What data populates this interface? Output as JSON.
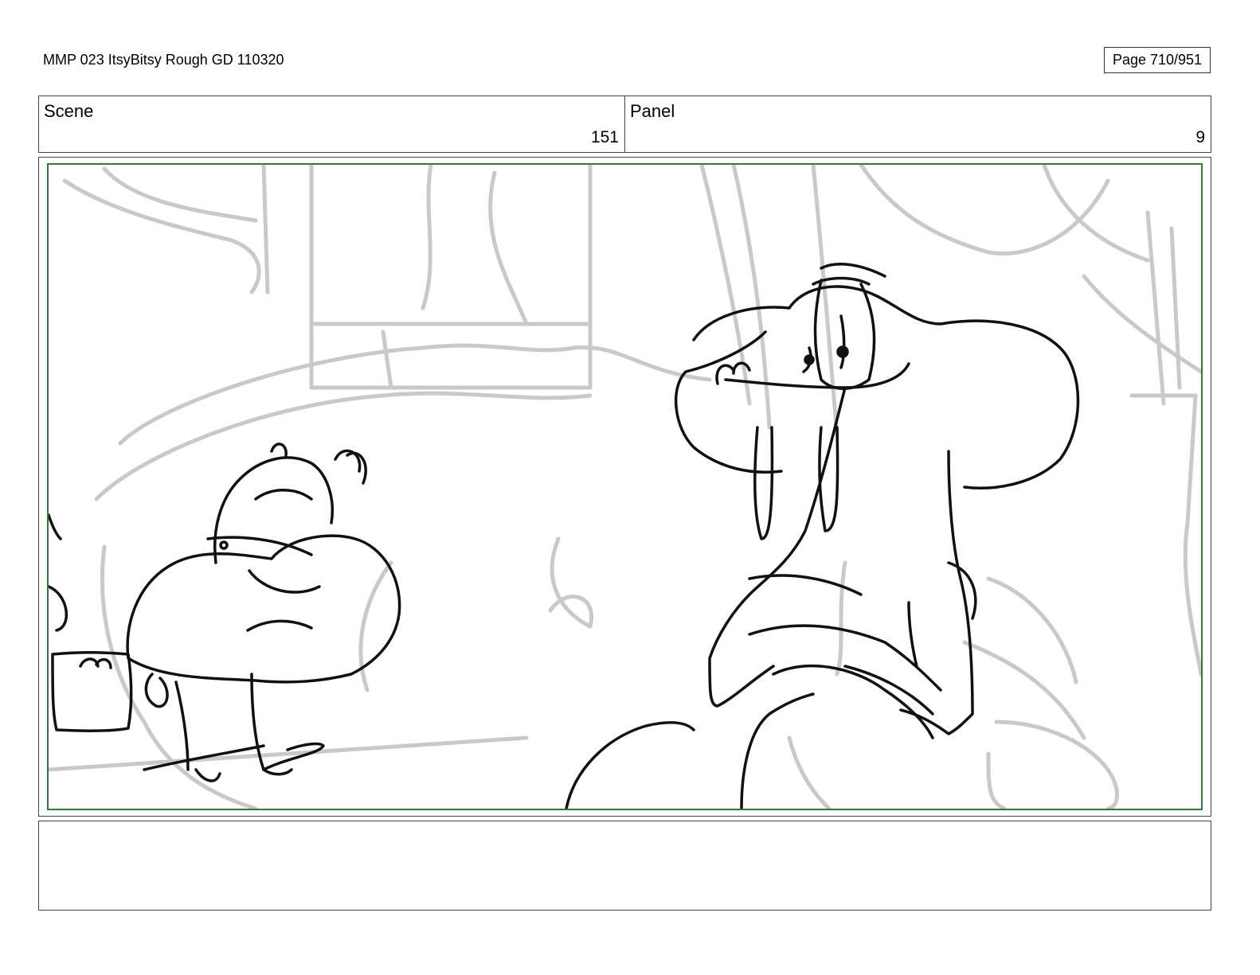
{
  "header": {
    "title": "MMP 023 ItsyBitsy Rough GD 110320",
    "page": "Page 710/951"
  },
  "scene": {
    "label": "Scene",
    "value": "151"
  },
  "panel": {
    "label": "Panel",
    "value": "9"
  },
  "notes": {
    "text": ""
  },
  "colors": {
    "frame_border": "#2e7d32",
    "sketch_line": "#111111",
    "background_line": "#c9c9c9"
  }
}
